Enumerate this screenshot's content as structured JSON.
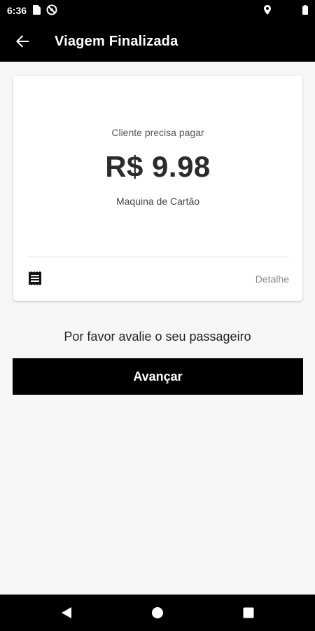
{
  "status_bar": {
    "time": "6:36",
    "icons": [
      "sim-card-icon",
      "no-disturb-icon",
      "location-icon",
      "battery-icon"
    ]
  },
  "app_bar": {
    "title": "Viagem Finalizada",
    "back_icon": "arrow-back-icon"
  },
  "payment_card": {
    "label": "Cliente precisa pagar",
    "amount": "R$ 9.98",
    "method": "Maquina de Cartão",
    "receipt_icon": "receipt-icon",
    "detail_label": "Detalhe"
  },
  "rating_prompt": "Por favor avalie o seu passageiro",
  "next_button": "Avançar",
  "nav_bar": {
    "icons": [
      "back-triangle-icon",
      "home-circle-icon",
      "recents-square-icon"
    ]
  },
  "colors": {
    "bar_background": "#000000",
    "page_background": "#f7f6f7",
    "card_background": "#ffffff",
    "detail_text": "#8a8a8a"
  }
}
